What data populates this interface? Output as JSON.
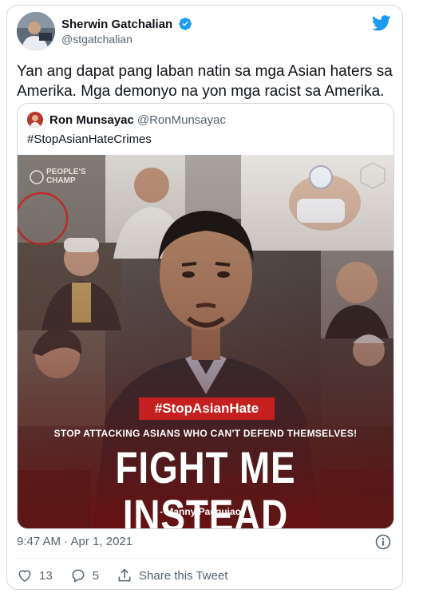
{
  "author": {
    "name": "Sherwin Gatchalian",
    "handle": "@stgatchalian"
  },
  "tweet": {
    "text": "Yan ang dapat pang laban natin sa mga Asian haters sa Amerika. Mga demonyo na yon mga racist sa Amerika.",
    "timestamp": "9:47 AM · Apr 1, 2021"
  },
  "quoted": {
    "name": "Ron Munsayac",
    "handle": "@RonMunsayac",
    "text": "#StopAsianHateCrimes",
    "image": {
      "watermark_line1": "PEOPLE'S",
      "watermark_line2": "CHAMP",
      "tag": "#StopAsianHate",
      "subheadline": "STOP ATTACKING ASIANS WHO CAN'T DEFEND THEMSELVES!",
      "headline": "FIGHT ME INSTEAD",
      "signature": "- Manny Pacquiao"
    }
  },
  "actions": {
    "likes": "13",
    "replies": "5",
    "share_label": "Share this Tweet"
  },
  "colors": {
    "twitter_blue": "#1d9bf0",
    "tag_red": "#c61f1f",
    "muted": "#536471"
  }
}
